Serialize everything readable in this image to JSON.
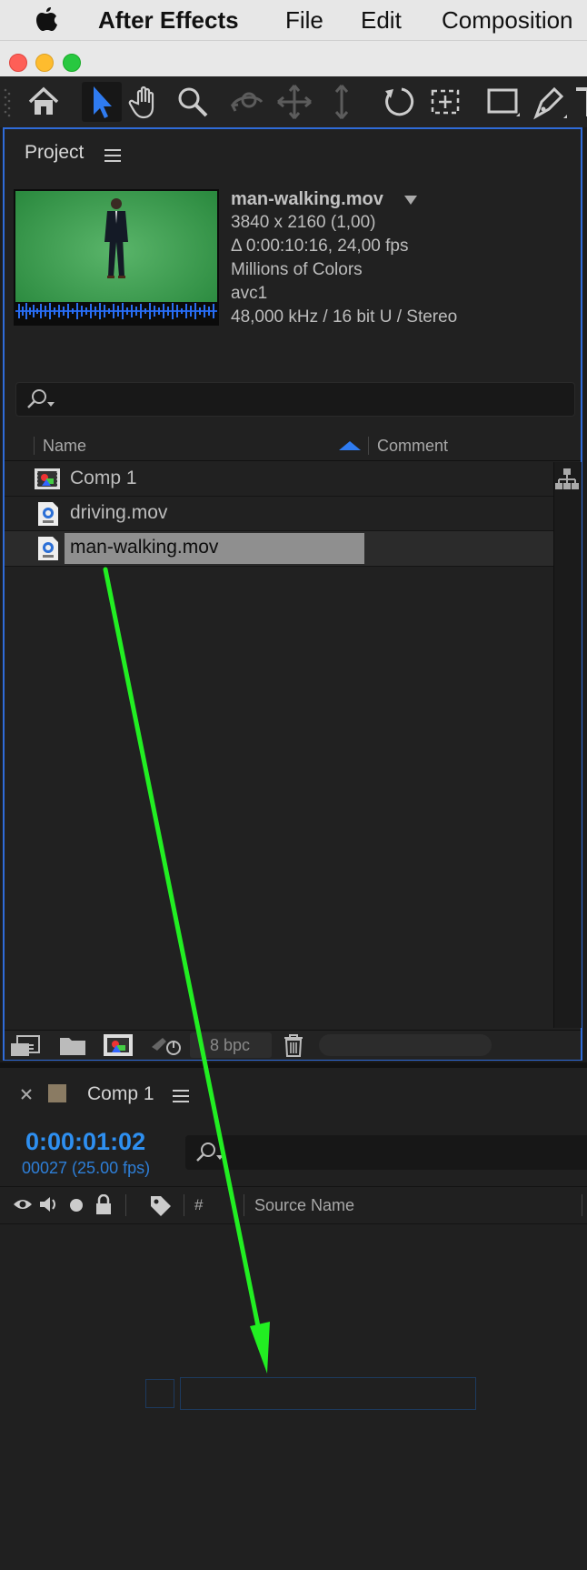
{
  "menubar": {
    "app": "After Effects",
    "items": [
      "File",
      "Edit",
      "Composition"
    ]
  },
  "project": {
    "title": "Project",
    "footage": {
      "name": "man-walking.mov",
      "resolution": "3840 x 2160 (1,00)",
      "duration": "Δ 0:00:10:16, 24,00 fps",
      "colors": "Millions of Colors",
      "codec": "avc1",
      "audio": "48,000 kHz / 16 bit U / Stereo"
    },
    "columns": {
      "name": "Name",
      "comment": "Comment"
    },
    "items": [
      {
        "label": "Comp 1",
        "icon": "composition-icon"
      },
      {
        "label": "driving.mov",
        "icon": "movie-file-icon"
      },
      {
        "label": "man-walking.mov",
        "icon": "movie-file-icon",
        "selected": true
      }
    ],
    "bit_depth": "8 bpc"
  },
  "timeline": {
    "tab": "Comp 1",
    "timecode": "0:00:01:02",
    "frames": "00027 (25.00 fps)",
    "columns": {
      "number": "#",
      "source_name": "Source Name"
    }
  },
  "colors": {
    "accent": "#2f6bd8",
    "timecode": "#2e8ff0",
    "arrow": "#22ee22",
    "selection": "#8f8f8f"
  }
}
